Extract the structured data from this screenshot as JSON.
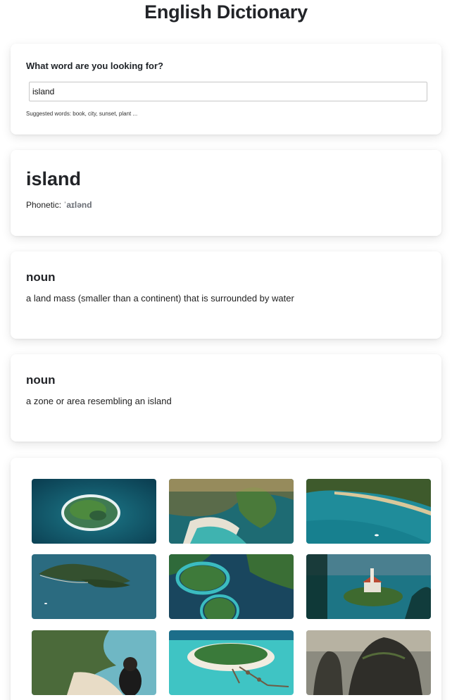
{
  "app": {
    "title": "English Dictionary"
  },
  "search": {
    "question": "What word are you looking for?",
    "value": "island",
    "hint": "Suggested words: book, city, sunset, plant ..."
  },
  "word": {
    "headword": "island",
    "phonetic_label": "Phonetic:",
    "phonetic": "ˈaɪlənd"
  },
  "meanings": [
    {
      "part_of_speech": "noun",
      "definition": "a land mass (smaller than a continent) that is surrounded by water"
    },
    {
      "part_of_speech": "noun",
      "definition": "a zone or area resembling an island"
    }
  ],
  "photos": [
    {
      "name": "photo-round-island-aerial"
    },
    {
      "name": "photo-cliff-beach-aerial"
    },
    {
      "name": "photo-turquoise-coast-aerial"
    },
    {
      "name": "photo-forested-island-sea"
    },
    {
      "name": "photo-green-islands-river"
    },
    {
      "name": "photo-lake-island-church"
    },
    {
      "name": "photo-cliff-viewpoint-person"
    },
    {
      "name": "photo-resort-island-lagoon"
    },
    {
      "name": "photo-sea-rocks"
    }
  ]
}
